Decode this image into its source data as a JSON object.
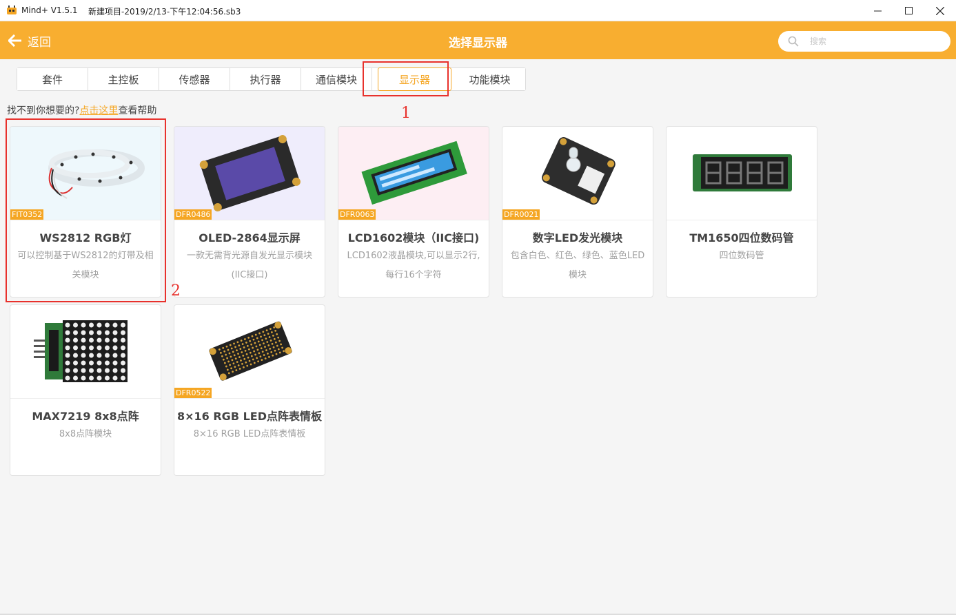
{
  "window": {
    "app_name": "Mind+ V1.5.1",
    "project_name": "新建项目-2019/2/13-下午12:04:56.sb3",
    "minimize": "—",
    "maximize": "☐",
    "close": "✕"
  },
  "header": {
    "back_label": "返回",
    "title": "选择显示器",
    "search_placeholder": "搜索",
    "search_value": ""
  },
  "tabs": [
    {
      "label": "套件",
      "active": false
    },
    {
      "label": "主控板",
      "active": false
    },
    {
      "label": "传感器",
      "active": false
    },
    {
      "label": "执行器",
      "active": false
    },
    {
      "label": "通信模块",
      "active": false
    },
    {
      "label": "显示器",
      "active": true
    },
    {
      "label": "功能模块",
      "active": false
    }
  ],
  "help": {
    "prefix": "找不到你想要的?",
    "link": "点击这里",
    "suffix": "查看帮助"
  },
  "annotations": {
    "one": "1",
    "two": "2",
    "color": "#e8312c"
  },
  "cards": [
    {
      "code": "FIT0352",
      "name": "WS2812 RGB灯",
      "desc": "可以控制基于WS2812的灯带及相关模块",
      "bg": "#eef8fc",
      "icon": "led-strip-image"
    },
    {
      "code": "DFR0486",
      "name": "OLED-2864显示屏",
      "desc": "一款无需背光源自发光显示模块(IIC接口)",
      "bg": "#efedfc",
      "icon": "oled-display-image"
    },
    {
      "code": "DFR0063",
      "name": "LCD1602模块（IIC接口)",
      "desc": "LCD1602液晶模块,可以显示2行,每行16个字符",
      "bg": "#fdeef3",
      "icon": "lcd1602-image"
    },
    {
      "code": "DFR0021",
      "name": "数字LED发光模块",
      "desc": "包含白色、红色、绿色、蓝色LED模块",
      "bg": "#ffffff",
      "icon": "led-module-image"
    },
    {
      "code": "",
      "name": "TM1650四位数码管",
      "desc": "四位数码管",
      "bg": "#ffffff",
      "icon": "seven-segment-image"
    },
    {
      "code": "",
      "name": "MAX7219 8x8点阵",
      "desc": "8x8点阵模块",
      "bg": "#ffffff",
      "icon": "dot-matrix-image"
    },
    {
      "code": "DFR0522",
      "name": "8×16 RGB LED点阵表情板",
      "desc": "8×16 RGB LED点阵表情板",
      "bg": "#ffffff",
      "icon": "rgb-matrix-image"
    }
  ],
  "colors": {
    "accent": "#f8ae30",
    "tag": "#f5a623"
  }
}
